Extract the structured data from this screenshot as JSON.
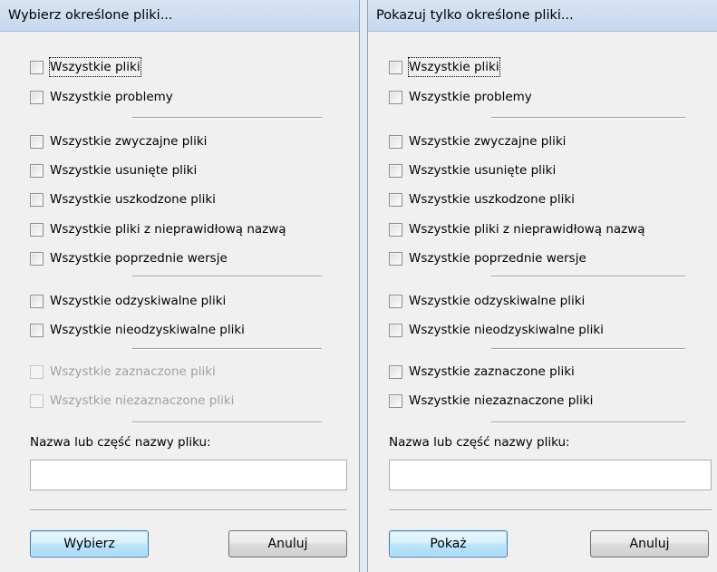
{
  "left": {
    "title": "Wybierz określone pliki...",
    "options": {
      "all_files": "Wszystkie pliki",
      "all_problems": "Wszystkie problemy",
      "regular": "Wszystkie zwyczajne pliki",
      "deleted": "Wszystkie usunięte pliki",
      "damaged": "Wszystkie uszkodzone pliki",
      "bad_name": "Wszystkie pliki z nieprawidłową nazwą",
      "previous": "Wszystkie poprzednie wersje",
      "recoverable": "Wszystkie odzyskiwalne pliki",
      "unrecoverable": "Wszystkie nieodzyskiwalne pliki",
      "selected": "Wszystkie zaznaczone pliki",
      "unselected": "Wszystkie niezaznaczone pliki"
    },
    "name_label": "Nazwa lub część nazwy pliku:",
    "name_value": "",
    "ok_label": "Wybierz",
    "cancel_label": "Anuluj"
  },
  "right": {
    "title": "Pokazuj tylko określone pliki...",
    "options": {
      "all_files": "Wszystkie pliki",
      "all_problems": "Wszystkie problemy",
      "regular": "Wszystkie zwyczajne pliki",
      "deleted": "Wszystkie usunięte pliki",
      "damaged": "Wszystkie uszkodzone pliki",
      "bad_name": "Wszystkie pliki z nieprawidłową nazwą",
      "previous": "Wszystkie poprzednie wersje",
      "recoverable": "Wszystkie odzyskiwalne pliki",
      "unrecoverable": "Wszystkie nieodzyskiwalne pliki",
      "selected": "Wszystkie zaznaczone pliki",
      "unselected": "Wszystkie niezaznaczone pliki"
    },
    "name_label": "Nazwa lub część nazwy pliku:",
    "name_value": "",
    "ok_label": "Pokaż",
    "cancel_label": "Anuluj"
  }
}
